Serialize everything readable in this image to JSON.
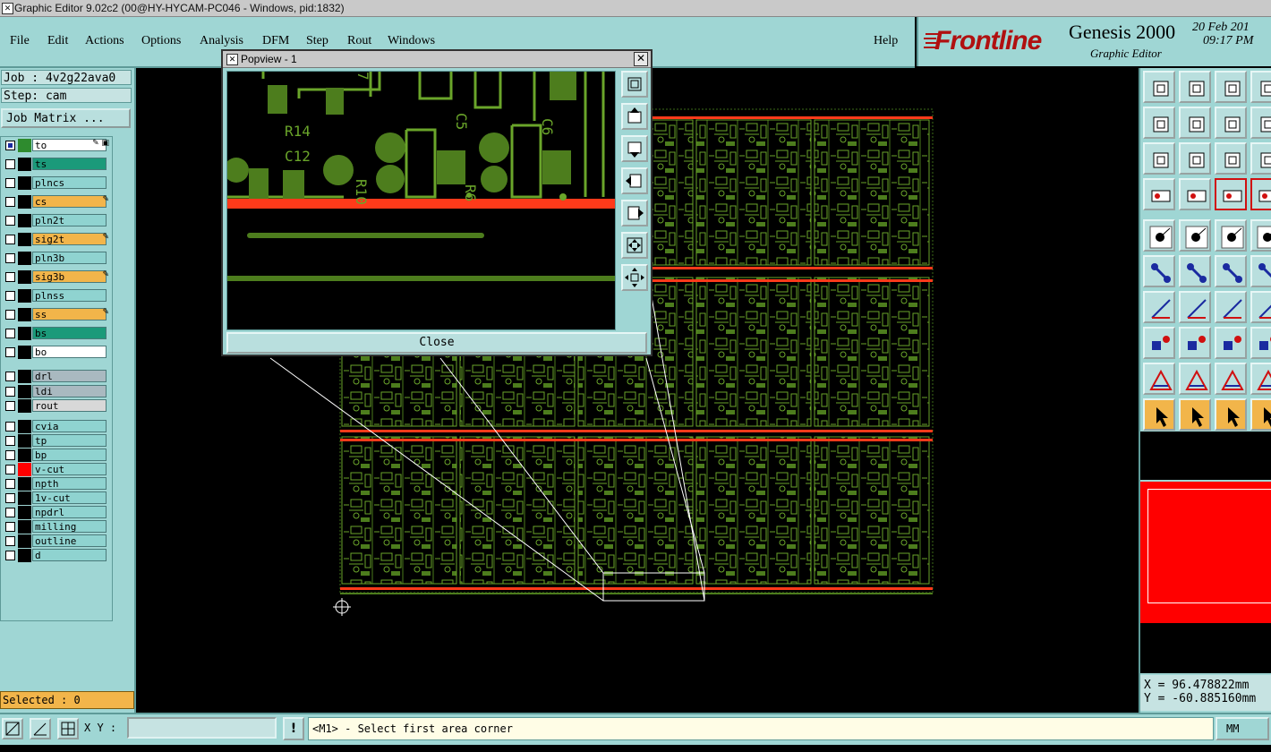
{
  "window": {
    "title": "Graphic Editor 9.02c2 (00@HY-HYCAM-PC046 - Windows, pid:1832)"
  },
  "menu": [
    "File",
    "Edit",
    "Actions",
    "Options",
    "Analysis",
    "DFM",
    "Step",
    "Rout",
    "Windows"
  ],
  "help_label": "Help",
  "brand": {
    "logo": "Frontline",
    "product": "Genesis 2000",
    "subtitle": "Graphic Editor",
    "date": "20 Feb 201",
    "time": "09:17 PM"
  },
  "job": {
    "job_label": "Job : 4v2g22ava0",
    "step_label": "Step: cam",
    "job_matrix_button": "Job Matrix ..."
  },
  "layers": [
    {
      "name": "to",
      "bg": "#ffffff",
      "color": "#2e8b2e",
      "flag": "✎ ▣",
      "checked": true
    },
    {
      "name": "ts",
      "bg": "#1b9a7a",
      "color": "#000000",
      "flag": "",
      "checked": false
    },
    {
      "name": "plncs",
      "bg": "#8fd3d0",
      "color": "#000000",
      "flag": "",
      "checked": false
    },
    {
      "name": "cs",
      "bg": "#f2b54a",
      "color": "#000000",
      "flag": "✎",
      "checked": false
    },
    {
      "name": "pln2t",
      "bg": "#8fd3d0",
      "color": "#000000",
      "flag": "",
      "checked": false
    },
    {
      "name": "sig2t",
      "bg": "#f2b54a",
      "color": "#000000",
      "flag": "✎",
      "checked": false
    },
    {
      "name": "pln3b",
      "bg": "#8fd3d0",
      "color": "#000000",
      "flag": "",
      "checked": false
    },
    {
      "name": "sig3b",
      "bg": "#f2b54a",
      "color": "#000000",
      "flag": "✎",
      "checked": false
    },
    {
      "name": "plnss",
      "bg": "#8fd3d0",
      "color": "#000000",
      "flag": "",
      "checked": false
    },
    {
      "name": "ss",
      "bg": "#f2b54a",
      "color": "#000000",
      "flag": "✎",
      "checked": false
    },
    {
      "name": "bs",
      "bg": "#1b9a7a",
      "color": "#000000",
      "flag": "",
      "checked": false
    },
    {
      "name": "bo",
      "bg": "#ffffff",
      "color": "#000000",
      "flag": "",
      "checked": false
    },
    {
      "name": "drl",
      "bg": "#a9b9c0",
      "color": "#000000",
      "flag": "",
      "checked": false
    },
    {
      "name": "ldi",
      "bg": "#a9b9c0",
      "color": "#000000",
      "flag": "",
      "checked": false
    },
    {
      "name": "rout",
      "bg": "#d8d8d8",
      "color": "#000000",
      "flag": "",
      "checked": false
    },
    {
      "name": "cvia",
      "bg": "#8fd3d0",
      "color": "#000000",
      "flag": "",
      "checked": false
    },
    {
      "name": "tp",
      "bg": "#8fd3d0",
      "color": "#000000",
      "flag": "",
      "checked": false
    },
    {
      "name": "bp",
      "bg": "#8fd3d0",
      "color": "#000000",
      "flag": "",
      "checked": false
    },
    {
      "name": "v-cut",
      "bg": "#8fd3d0",
      "color": "#ff0000",
      "flag": "",
      "checked": false
    },
    {
      "name": "npth",
      "bg": "#8fd3d0",
      "color": "#000000",
      "flag": "",
      "checked": false
    },
    {
      "name": "1v-cut",
      "bg": "#8fd3d0",
      "color": "#000000",
      "flag": "",
      "checked": false
    },
    {
      "name": "npdrl",
      "bg": "#8fd3d0",
      "color": "#000000",
      "flag": "",
      "checked": false
    },
    {
      "name": "milling",
      "bg": "#8fd3d0",
      "color": "#000000",
      "flag": "",
      "checked": false
    },
    {
      "name": "outline",
      "bg": "#8fd3d0",
      "color": "#000000",
      "flag": "",
      "checked": false
    },
    {
      "name": "d",
      "bg": "#8fd3d0",
      "color": "#000000",
      "flag": "",
      "checked": false
    }
  ],
  "selected_label": "Selected : 0",
  "statusbar": {
    "xy_label": "X Y :",
    "xy_value": "",
    "exclaim": "!",
    "message": "<M1> - Select first area corner",
    "units": "MM"
  },
  "coords": {
    "x": "X = 96.478822mm",
    "y": "Y = -60.885160mm"
  },
  "popview": {
    "title": "Popview - 1",
    "close_label": "Close",
    "labels": [
      "R14",
      "C12",
      "C5",
      "C6",
      "R10",
      "R6",
      "7"
    ]
  },
  "colors": {
    "panel": "#9fd6d4",
    "trace": "#6aa52a",
    "stripe": "#ff3a1a",
    "map": "#ff0000"
  }
}
